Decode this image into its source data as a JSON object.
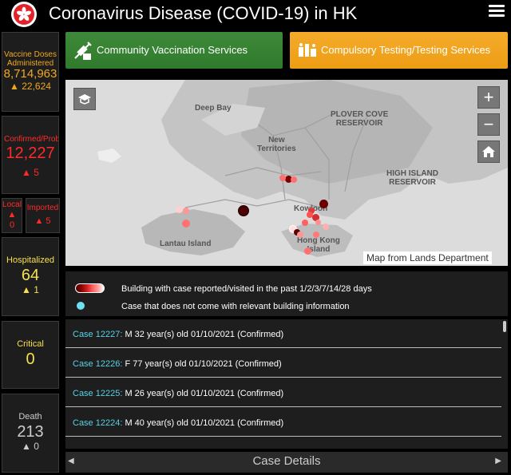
{
  "header": {
    "title": "Coronavirus Disease (COVID-19) in HK",
    "logo_icon": "hk-bauhinia-icon",
    "menu_icon": "hamburger-menu-icon"
  },
  "stats": {
    "vaccine": {
      "label": "Vaccine Doses Administered",
      "value": "8,714,963",
      "delta": "▲ 22,624"
    },
    "confirmed": {
      "label": "Confirmed/Prob",
      "value": "12,227",
      "delta": "▲ 5"
    },
    "local": {
      "label": "Local",
      "arrow": "▲",
      "value": "0"
    },
    "imported": {
      "label": "Imported",
      "delta": "▲ 5"
    },
    "hospitalized": {
      "label": "Hospitalized",
      "value": "64",
      "delta": "▲ 1"
    },
    "critical": {
      "label": "Critical",
      "value": "0"
    },
    "death": {
      "label": "Death",
      "value": "213",
      "delta": "▲ 0"
    }
  },
  "buttons": {
    "vaccination": "Community Vaccination Services",
    "testing": "Compulsory Testing/Testing Services"
  },
  "map": {
    "labels": {
      "deep_bay": "Deep Bay",
      "plover_cove": "PLOVER COVE\nRESERVOIR",
      "new_territories": "New\nTerritories",
      "high_island": "HIGH ISLAND\nRESERVOIR",
      "kowloon": "Kowloon",
      "lantau": "Lantau Island",
      "hong_kong_island": "Hong Kong\nIsland"
    },
    "credit": "Map from Lands Department",
    "zoom_in": "+",
    "zoom_out": "−"
  },
  "legend": {
    "building_text": "Building with case reported/visited in the past 1/2/3/7/14/28 days",
    "no_building_text": "Case that does not come with relevant building information"
  },
  "cases": [
    {
      "id": "Case 12227:",
      "desc": " M  32 year(s) old  01/10/2021 (Confirmed)"
    },
    {
      "id": "Case 12226:",
      "desc": " F  77 year(s) old  01/10/2021 (Confirmed)"
    },
    {
      "id": "Case 12225:",
      "desc": " M  26 year(s) old  01/10/2021 (Confirmed)"
    },
    {
      "id": "Case 12224:",
      "desc": " M  40 year(s) old  01/10/2021 (Confirmed)"
    }
  ],
  "footer": {
    "title": "Case Details",
    "left_arrow": "◀",
    "right_arrow": "▶"
  },
  "colors": {
    "vaccine": "#f2a81d",
    "confirmed": "#ff2a2a",
    "hospital": "#f6e04e",
    "case_id": "#57d3e6",
    "button_green": "#3e8a3a",
    "button_orange": "#f4ab2a"
  }
}
